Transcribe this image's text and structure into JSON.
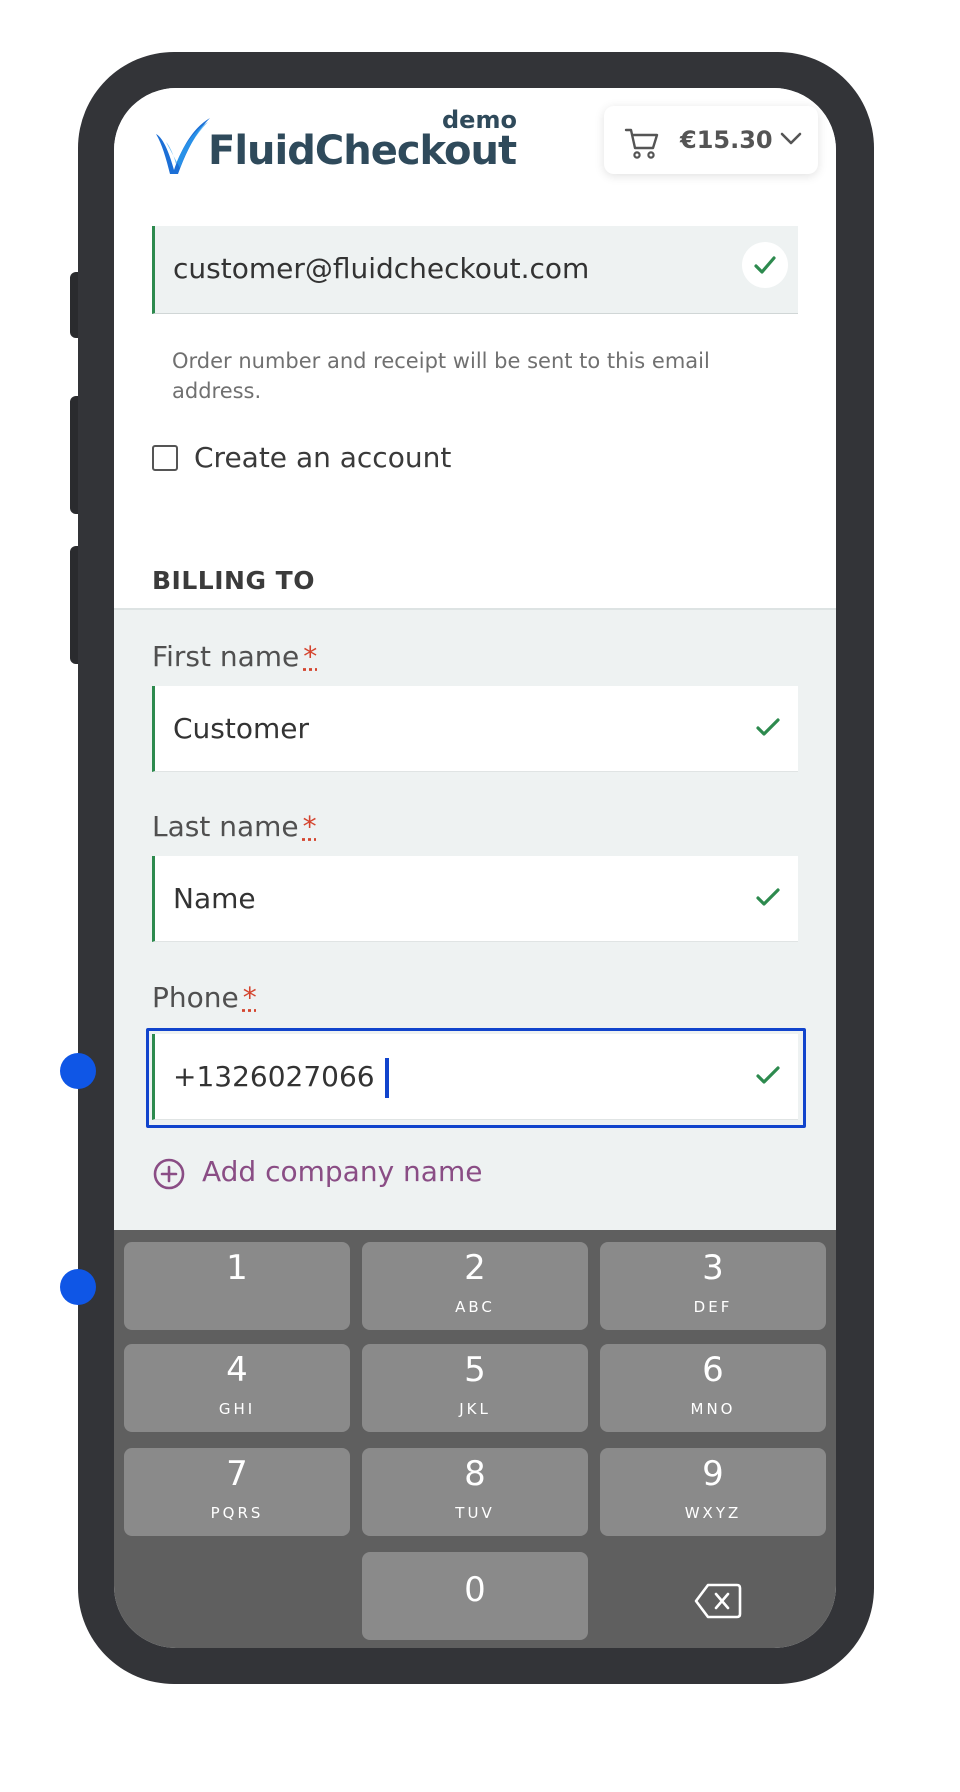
{
  "header": {
    "logo_text": "FluidCheckout",
    "logo_badge": "demo",
    "cart_total": "€15.30"
  },
  "contact": {
    "email_value": "customer@fluidcheckout.com",
    "email_help": "Order number and receipt will be sent to this email address.",
    "create_account_label": "Create an account",
    "create_account_checked": false
  },
  "billing": {
    "title": "BILLING TO",
    "required_mark": "*",
    "first_name_label": "First name",
    "first_name_value": "Customer",
    "last_name_label": "Last name",
    "last_name_value": "Name",
    "phone_label": "Phone",
    "phone_value": "+1326027066",
    "add_company_label": "Add company name"
  },
  "keypad": {
    "keys": [
      {
        "num": "1",
        "letters": ""
      },
      {
        "num": "2",
        "letters": "ABC"
      },
      {
        "num": "3",
        "letters": "DEF"
      },
      {
        "num": "4",
        "letters": "GHI"
      },
      {
        "num": "5",
        "letters": "JKL"
      },
      {
        "num": "6",
        "letters": "MNO"
      },
      {
        "num": "7",
        "letters": "PQRS"
      },
      {
        "num": "8",
        "letters": "TUV"
      },
      {
        "num": "9",
        "letters": "WXYZ"
      },
      {
        "num": "0",
        "letters": ""
      }
    ]
  },
  "colors": {
    "valid_green": "#2d8a4e",
    "focus_blue": "#1144cc",
    "link_purple": "#8a4d85",
    "required_red": "#d4442e",
    "marker_blue": "#0f56e6"
  }
}
